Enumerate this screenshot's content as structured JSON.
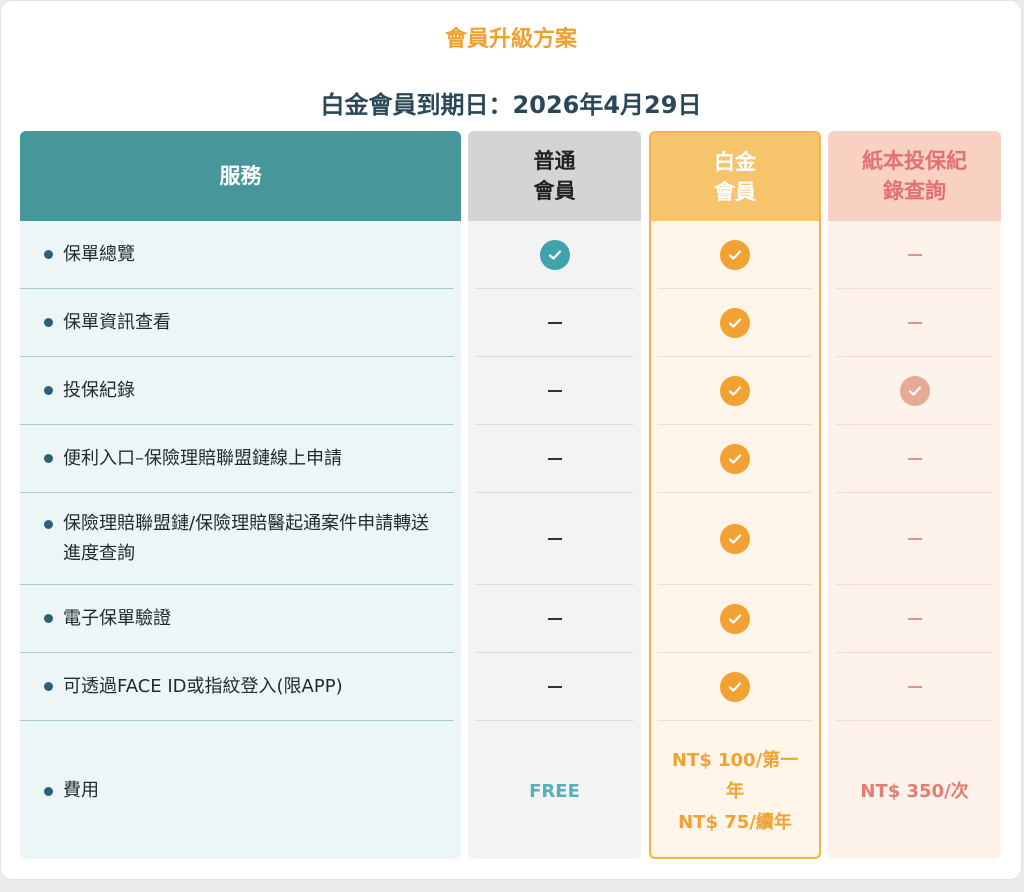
{
  "page": {
    "title": "會員升級方案",
    "expiry": "白金會員到期日：2026年4月29日"
  },
  "columns": {
    "service": "服務",
    "normal": "普通\n會員",
    "platinum": "白金\n會員",
    "paper": "紙本投保紀\n錄查詢"
  },
  "rows": [
    {
      "service": "保單總覽",
      "normal": "check",
      "platinum": "check",
      "paper": "dash"
    },
    {
      "service": "保單資訊查看",
      "normal": "dash",
      "platinum": "check",
      "paper": "dash"
    },
    {
      "service": "投保紀錄",
      "normal": "dash",
      "platinum": "check",
      "paper": "check"
    },
    {
      "service": "便利入口–保險理賠聯盟鏈線上申請",
      "normal": "dash",
      "platinum": "check",
      "paper": "dash"
    },
    {
      "service": "保險理賠聯盟鏈/保險理賠醫起通案件申請轉送進度查詢",
      "normal": "dash",
      "platinum": "check",
      "paper": "dash"
    },
    {
      "service": "電子保單驗證",
      "normal": "dash",
      "platinum": "check",
      "paper": "dash"
    },
    {
      "service": "可透過FACE ID或指紋登入(限APP)",
      "normal": "dash",
      "platinum": "check",
      "paper": "dash"
    }
  ],
  "fee": {
    "label": "費用",
    "normal": "FREE",
    "platinum": "NT$ 100/第一\n年\nNT$ 75/續年",
    "paper": "NT$ 350/次"
  },
  "colors": {
    "title": "#f0a030",
    "service_header": "#46969a",
    "platinum_accent": "#f2a232",
    "normal_check": "#3fa3ab",
    "paper_accent": "#e37c74"
  },
  "icons": {
    "included": "check-circle-icon",
    "not_included": "dash-icon"
  }
}
